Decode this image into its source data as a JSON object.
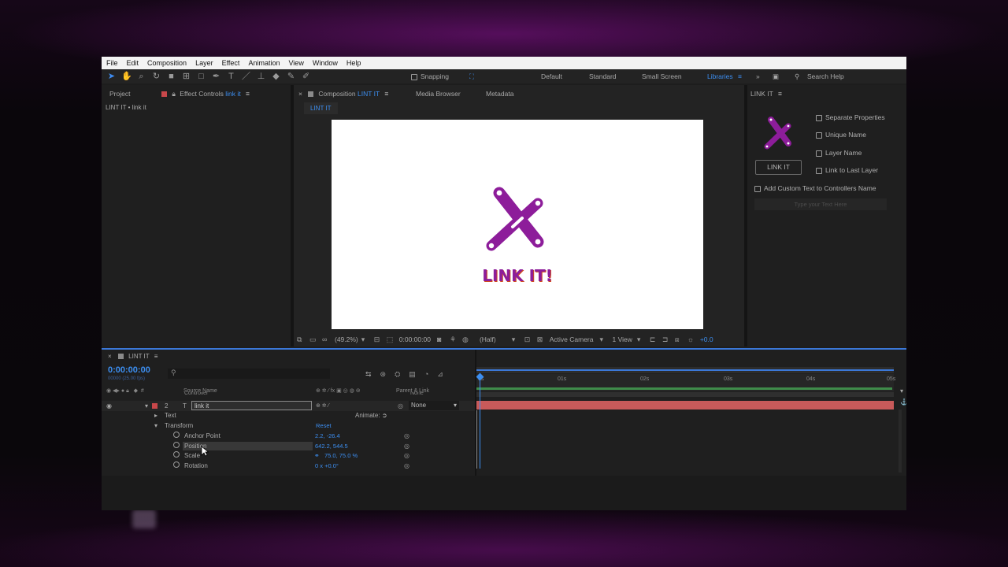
{
  "menu": [
    "File",
    "Edit",
    "Composition",
    "Layer",
    "Effect",
    "Animation",
    "View",
    "Window",
    "Help"
  ],
  "toolbar": {
    "snapping_label": "Snapping",
    "workspaces": [
      "Default",
      "Standard",
      "Small Screen"
    ],
    "libraries_label": "Libraries",
    "search_placeholder": "Search Help"
  },
  "project_panel": {
    "tab_project": "Project",
    "tab_effect_controls": "Effect Controls",
    "effect_controls_layer": "link it",
    "subheader": "LINT IT • link it"
  },
  "comp_panel": {
    "tab_composition": "Composition",
    "composition_name": "LINT IT",
    "tab_media_browser": "Media Browser",
    "tab_metadata": "Metadata",
    "comp_tab": "LINT IT",
    "logo_text": "LINK IT!",
    "zoom": "(49.2%)",
    "timecode": "0:00:00:00",
    "resolution": "(Half)",
    "camera": "Active Camera",
    "views": "1 View",
    "exposure": "+0.0"
  },
  "link_it_panel": {
    "title": "LINK IT",
    "button_label": "LINK IT",
    "options": [
      "Separate Properties",
      "Unique Name",
      "Layer Name",
      "Link to Last Layer"
    ],
    "custom_text_label": "Add Custom Text to Controllers Name",
    "custom_text_placeholder": "Type your Text Here"
  },
  "timeline": {
    "tab": "LINT IT",
    "current_time": "0:00:00:00",
    "fps_label": "00000 (25.00 fps)",
    "col_source_name": "Source Name",
    "col_parent_link": "Parent & Link",
    "hidden_layer_name": "Controller",
    "layer_number": "2",
    "layer_name": "link it",
    "parent_value": "None",
    "parent_value_row1": "None",
    "text_group": "Text",
    "animate_label": "Animate:",
    "transform_group": "Transform",
    "reset_label": "Reset",
    "properties": [
      {
        "name": "Anchor Point",
        "value": "2.2, -26.4"
      },
      {
        "name": "Position",
        "value": "642.2, 544.5"
      },
      {
        "name": "Scale",
        "value": "75.0, 75.0 %"
      },
      {
        "name": "Rotation",
        "value": "0 x +0.0°"
      }
    ],
    "ruler_labels": [
      "0s",
      "01s",
      "02s",
      "03s",
      "04s",
      "05s"
    ]
  },
  "colors": {
    "accent_blue": "#3c8ef0",
    "logo_purple": "#8d1d9a",
    "layer_bar": "#c85a5a",
    "work_area_green": "#3f8b4a"
  }
}
